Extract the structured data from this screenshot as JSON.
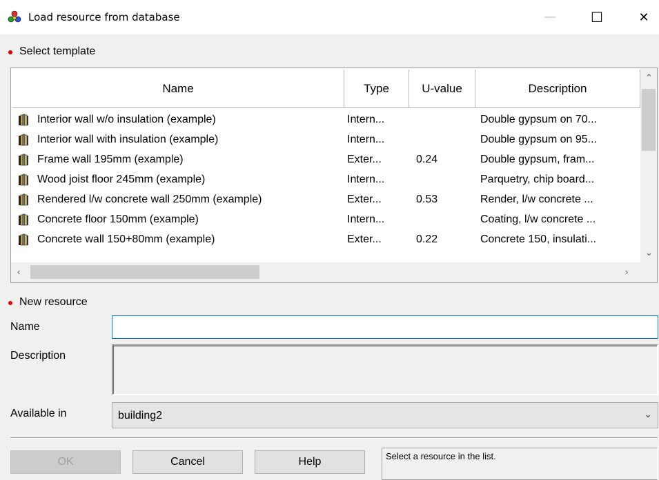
{
  "window": {
    "title": "Load resource from database",
    "minimize_glyph": "—",
    "maximize_glyph": "☐",
    "close_glyph": "✕"
  },
  "select_template": {
    "label": "Select template",
    "columns": [
      "Name",
      "Type",
      "U-value",
      "Description"
    ],
    "rows": [
      {
        "name": "Interior wall w/o insulation (example)",
        "type": "Intern...",
        "uvalue": "",
        "description": "Double gypsum on 70..."
      },
      {
        "name": "Interior wall with insulation (example)",
        "type": "Intern...",
        "uvalue": "",
        "description": "Double gypsum on 95..."
      },
      {
        "name": "Frame wall 195mm (example)",
        "type": "Exter...",
        "uvalue": "0.24",
        "description": "Double gypsum, fram..."
      },
      {
        "name": "Wood joist floor 245mm (example)",
        "type": "Intern...",
        "uvalue": "",
        "description": "Parquetry, chip board..."
      },
      {
        "name": "Rendered l/w concrete wall 250mm (example)",
        "type": "Exter...",
        "uvalue": "0.53",
        "description": "Render, l/w concrete ..."
      },
      {
        "name": "Concrete floor 150mm (example)",
        "type": "Intern...",
        "uvalue": "",
        "description": "Coating, l/w concrete ..."
      },
      {
        "name": "Concrete wall 150+80mm (example)",
        "type": "Exter...",
        "uvalue": "0.22",
        "description": "Concrete 150, insulati..."
      }
    ],
    "row_icon": "wall-layers-icon"
  },
  "new_resource": {
    "label": "New resource",
    "name_label": "Name",
    "name_value": "",
    "description_label": "Description",
    "available_label": "Available in",
    "available_value": "building2"
  },
  "buttons": {
    "ok": "OK",
    "cancel": "Cancel",
    "help": "Help"
  },
  "status_text": "Select a resource in the list.",
  "colors": {
    "accent_dot": "#e00000",
    "input_focus": "#0078d7"
  }
}
